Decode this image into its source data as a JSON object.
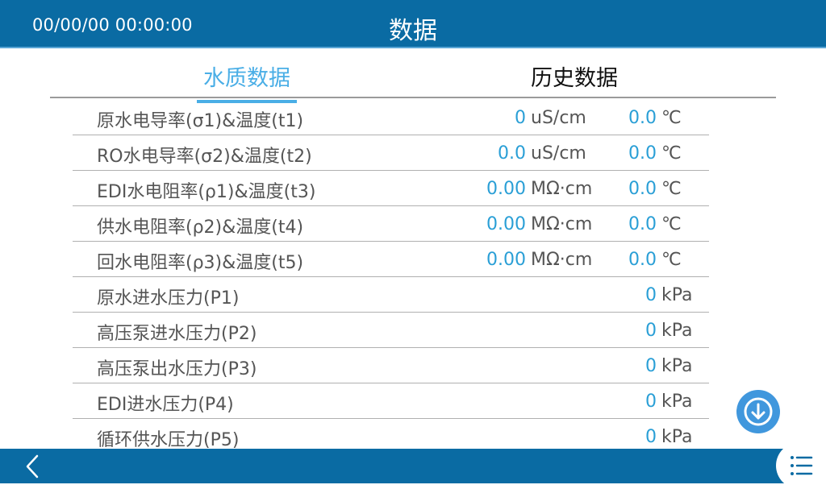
{
  "header": {
    "datetime": "00/00/00 00:00:00",
    "title": "数据"
  },
  "tabs": [
    {
      "label": "水质数据",
      "active": true
    },
    {
      "label": "历史数据",
      "active": false
    }
  ],
  "rows": [
    {
      "label": "原水电导率(σ1)&温度(t1)",
      "value": "0",
      "unit": "uS/cm",
      "temp": "0.0",
      "temp_unit": "℃"
    },
    {
      "label": "RO水电导率(σ2)&温度(t2)",
      "value": "0.0",
      "unit": "uS/cm",
      "temp": "0.0",
      "temp_unit": "℃"
    },
    {
      "label": "EDI水电阻率(ρ1)&温度(t3)",
      "value": "0.00",
      "unit": "MΩ·cm",
      "temp": "0.0",
      "temp_unit": "℃"
    },
    {
      "label": "供水电阻率(ρ2)&温度(t4)",
      "value": "0.00",
      "unit": "MΩ·cm",
      "temp": "0.0",
      "temp_unit": "℃"
    },
    {
      "label": "回水电阻率(ρ3)&温度(t5)",
      "value": "0.00",
      "unit": "MΩ·cm",
      "temp": "0.0",
      "temp_unit": "℃"
    },
    {
      "label": "原水进水压力(P1)",
      "value": "0",
      "unit": "kPa"
    },
    {
      "label": "高压泵进水压力(P2)",
      "value": "0",
      "unit": "kPa"
    },
    {
      "label": "高压泵出水压力(P3)",
      "value": "0",
      "unit": "kPa"
    },
    {
      "label": "EDI进水压力(P4)",
      "value": "0",
      "unit": "kPa"
    },
    {
      "label": "循环供水压力(P5)",
      "value": "0",
      "unit": "kPa"
    }
  ],
  "colors": {
    "bar": "#0a6ba3",
    "accent": "#4aaee6",
    "value": "#2a9fd6",
    "button": "#4097dd"
  },
  "icons": {
    "scroll_down": "arrow-down-icon",
    "back": "chevron-left-icon",
    "menu": "list-menu-icon"
  }
}
